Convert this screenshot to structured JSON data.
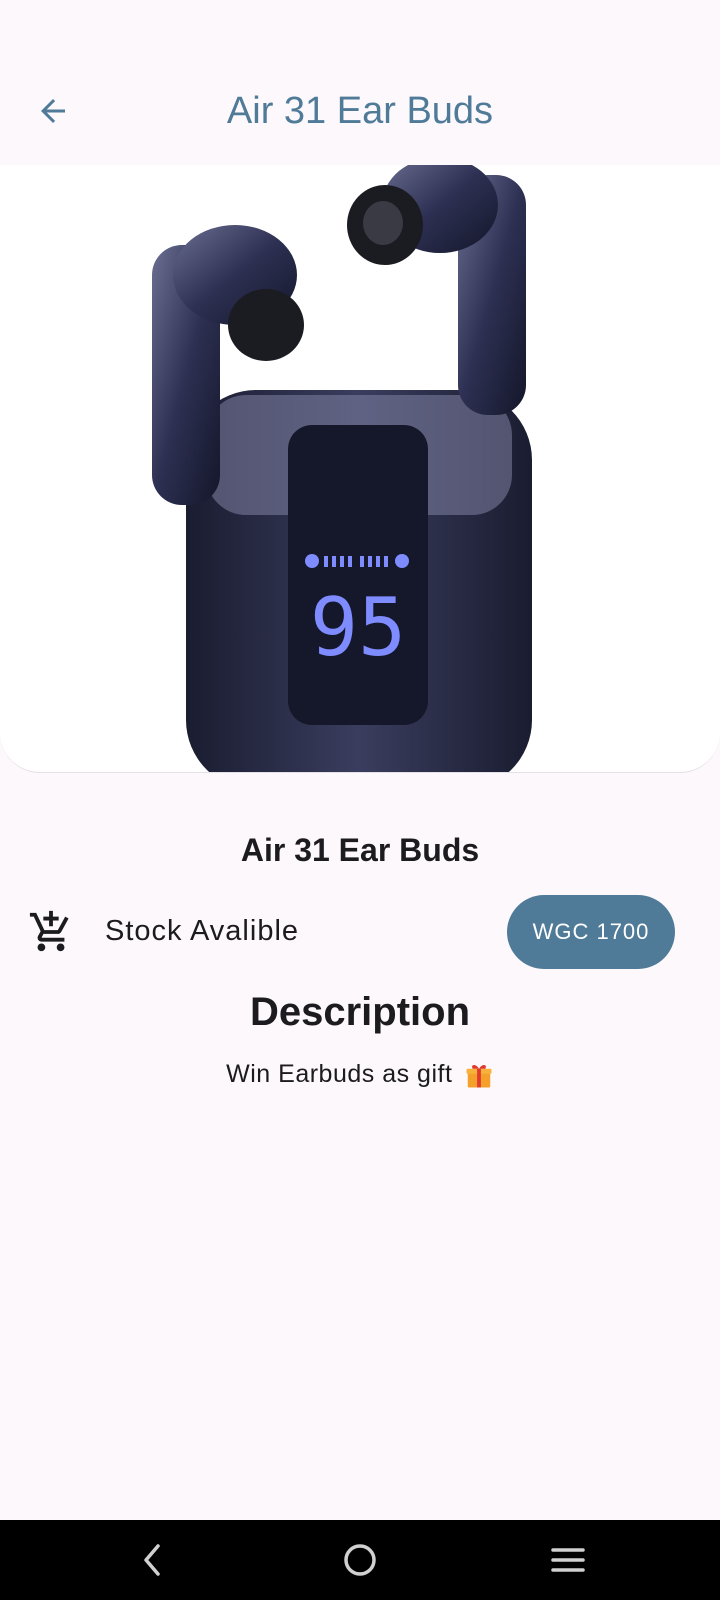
{
  "app_bar": {
    "title": "Air 31 Ear Buds",
    "back_icon": "arrow-back-icon"
  },
  "hero": {
    "image": "wireless-earbuds-with-charging-case",
    "case_display_number": "95"
  },
  "product": {
    "name": "Air 31 Ear Buds",
    "stock_text": "Stock Avalible",
    "price_label": "WGC 1700",
    "description_heading": "Description",
    "description_text": "Win Earbuds as gift"
  },
  "nav_bar": {
    "back": "nav-back-icon",
    "home": "nav-home-icon",
    "menu": "nav-menu-icon"
  },
  "colors": {
    "accent": "#4f7b99",
    "background": "#fdf8fb",
    "text": "#1c1b1f",
    "nav_background": "#000000"
  }
}
